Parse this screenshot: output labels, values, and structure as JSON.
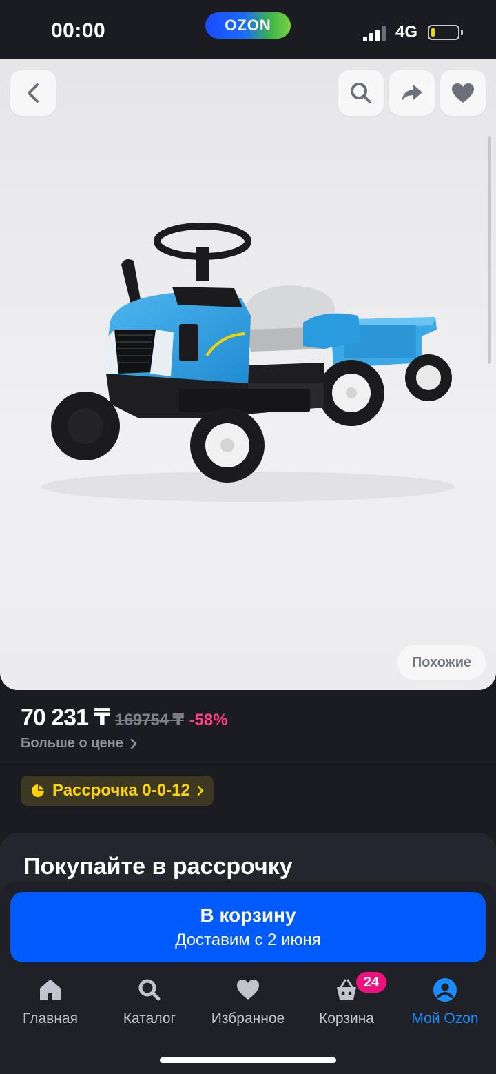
{
  "status_bar": {
    "time": "00:00",
    "app_logo_text": "OZON",
    "network": "4G",
    "battery_level": 0.15,
    "signal_bars_filled": 3
  },
  "top_actions": {
    "back_icon": "chevron-left-icon",
    "search_icon": "search-icon",
    "share_icon": "share-arrow-icon",
    "favorite_icon": "heart-icon"
  },
  "product_image": {
    "similar_label": "Похожие"
  },
  "price": {
    "current": "70 231 ₸",
    "old": "169754 ₸",
    "discount": "-58%",
    "more_label": "Больше о цене"
  },
  "installment": {
    "label": "Рассрочка 0-0-12",
    "icon": "pie-chart-icon",
    "color": "#ffd400"
  },
  "promo_card": {
    "title": "Покупайте в рассрочку"
  },
  "cart_button": {
    "label": "В корзину",
    "sublabel": "Доставим с 2 июня",
    "color": "#005bff"
  },
  "tabbar": {
    "items": [
      {
        "label": "Главная",
        "icon": "home-icon"
      },
      {
        "label": "Каталог",
        "icon": "search-icon"
      },
      {
        "label": "Избранное",
        "icon": "heart-icon"
      },
      {
        "label": "Корзина",
        "icon": "basket-icon",
        "badge": "24"
      },
      {
        "label": "Мой Ozon",
        "icon": "user-circle-icon",
        "active": true
      }
    ],
    "active_color": "#1a8cff",
    "badge_color": "#f1117e"
  }
}
